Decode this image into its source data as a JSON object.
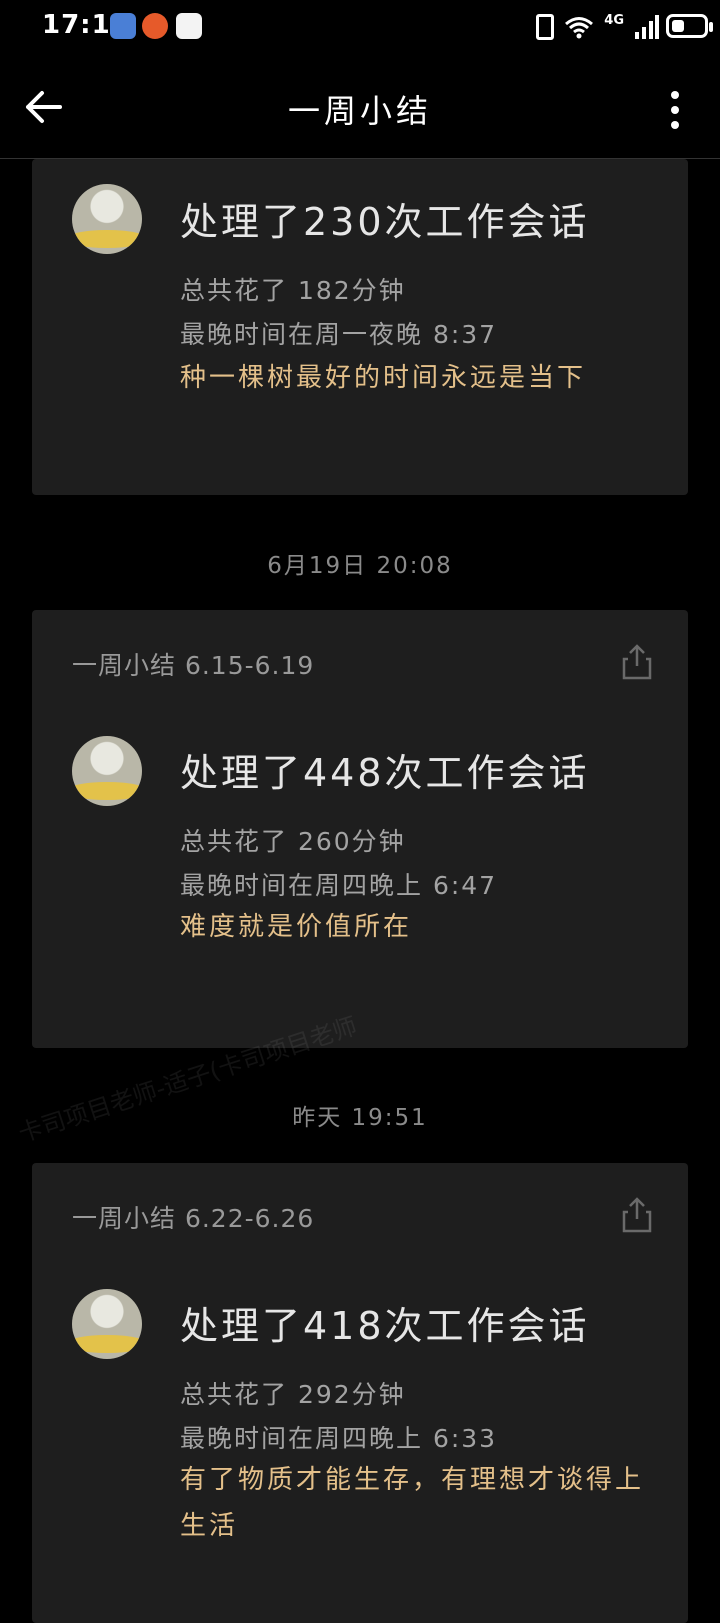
{
  "status_bar": {
    "time": "17:11",
    "network": "4G",
    "battery_level": 0.4
  },
  "nav": {
    "title": "一周小结"
  },
  "cards": [
    {
      "main": "处理了230次工作会话",
      "total": "总共花了 182分钟",
      "latest": "最晚时间在周一夜晚 8:37",
      "quote": "种一棵树最好的时间永远是当下"
    },
    {
      "header": "一周小结 6.15-6.19",
      "main": "处理了448次工作会话",
      "total": "总共花了 260分钟",
      "latest": "最晚时间在周四晚上 6:47",
      "quote": "难度就是价值所在"
    },
    {
      "header": "一周小结 6.22-6.26",
      "main": "处理了418次工作会话",
      "total": "总共花了 292分钟",
      "latest": "最晚时间在周四晚上 6:33",
      "quote": "有了物质才能生存，有理想才谈得上生活"
    }
  ],
  "timestamps": [
    "6月19日  20:08",
    "昨天  19:51"
  ],
  "watermark": "卡司项目老师-适子(卡司项目老师"
}
